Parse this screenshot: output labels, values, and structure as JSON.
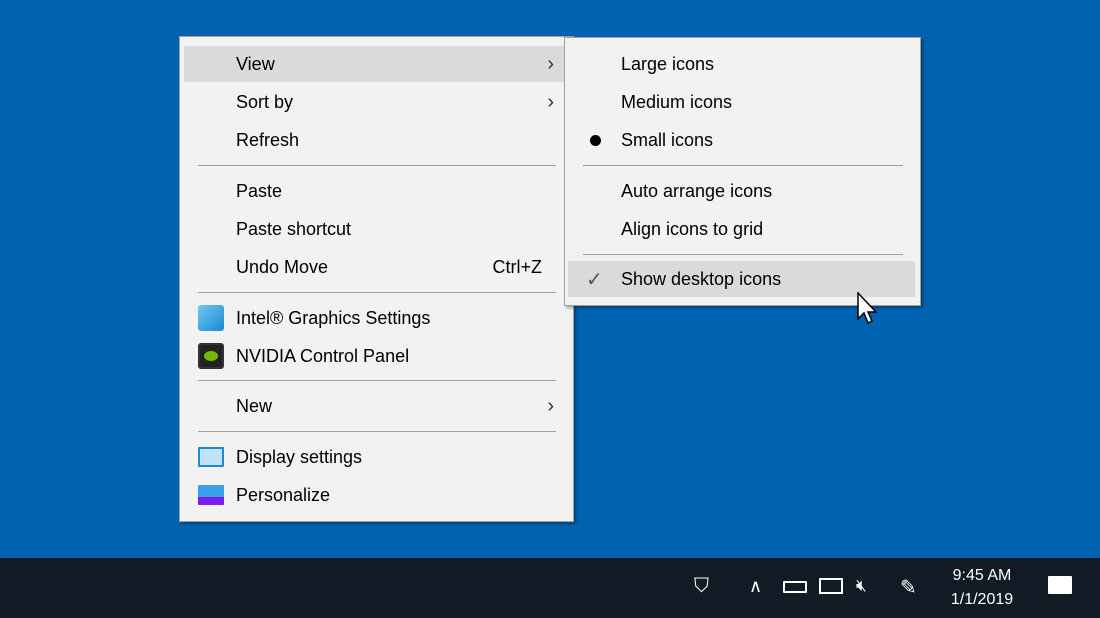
{
  "context_menu": {
    "items": [
      {
        "label": "View",
        "submenu": true
      },
      {
        "label": "Sort by",
        "submenu": true
      },
      {
        "label": "Refresh"
      },
      {
        "label": "Paste"
      },
      {
        "label": "Paste shortcut"
      },
      {
        "label": "Undo Move",
        "shortcut": "Ctrl+Z"
      },
      {
        "label": "Intel® Graphics Settings"
      },
      {
        "label": "NVIDIA Control Panel"
      },
      {
        "label": "New",
        "submenu": true
      },
      {
        "label": "Display settings"
      },
      {
        "label": "Personalize"
      }
    ]
  },
  "view_submenu": {
    "items": [
      {
        "label": "Large icons"
      },
      {
        "label": "Medium icons"
      },
      {
        "label": "Small icons",
        "selected": true
      },
      {
        "label": "Auto arrange icons"
      },
      {
        "label": "Align icons to grid"
      },
      {
        "label": "Show desktop icons",
        "checked": true
      }
    ]
  },
  "taskbar": {
    "time": "9:45 AM",
    "date": "1/1/2019"
  },
  "colors": {
    "desktop": "#0063b1",
    "taskbar": "#101b26",
    "menu": "#f2f2f2",
    "highlight": "#dadada"
  }
}
